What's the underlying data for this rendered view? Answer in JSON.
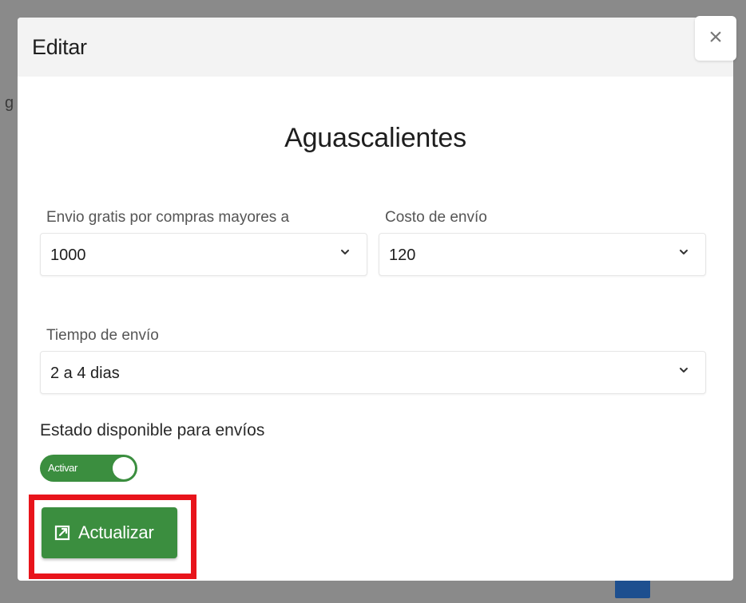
{
  "background": {
    "partial_letter": "g"
  },
  "dialog": {
    "title": "Editar",
    "close_label": "×",
    "state_name": "Aguascalientes",
    "free_shipping": {
      "label": "Envio gratis por compras mayores a",
      "value": "1000"
    },
    "shipping_cost": {
      "label": "Costo de envío",
      "value": "120"
    },
    "shipping_time": {
      "label": "Tiempo de envío",
      "value": "2 a 4 dias"
    },
    "availability": {
      "label": "Estado disponible para envíos",
      "toggle_text": "Activar",
      "enabled": true
    },
    "update_button": {
      "label": "Actualizar",
      "icon": "edit-external-icon"
    }
  },
  "colors": {
    "accent_green": "#3b8e3f",
    "highlight_red": "#e8141b",
    "pager_active": "#1d4f8f"
  }
}
